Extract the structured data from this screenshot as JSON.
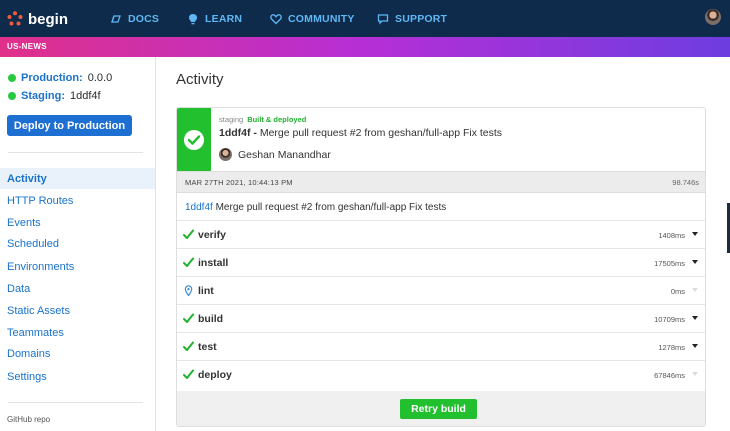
{
  "topnav": {
    "logo_text": "begin",
    "links": [
      {
        "label": "DOCS",
        "icon": "docs-icon"
      },
      {
        "label": "LEARN",
        "icon": "lightbulb-icon"
      },
      {
        "label": "COMMUNITY",
        "icon": "heart-icon"
      },
      {
        "label": "SUPPORT",
        "icon": "chat-icon"
      }
    ]
  },
  "appbar": {
    "app_name": "US-NEWS"
  },
  "sidebar": {
    "production_label": "Production:",
    "production_value": "0.0.0",
    "staging_label": "Staging:",
    "staging_value": "1ddf4f",
    "deploy_button": "Deploy to Production",
    "nav": [
      "Activity",
      "HTTP Routes",
      "Events",
      "Scheduled",
      "Environments",
      "Data",
      "Static Assets",
      "Teammates",
      "Domains",
      "Settings"
    ],
    "active_nav": "Activity",
    "github_link": "GitHub repo"
  },
  "main": {
    "title": "Activity",
    "build": {
      "env": "staging",
      "status": "Built & deployed",
      "sha": "1ddf4f",
      "separator": " - ",
      "commit_message": "Merge pull request #2 from geshan/full-app Fix tests",
      "author": "Geshan Manandhar",
      "date": "MAR 27TH 2021, 10:44:13 PM",
      "duration": "98.746s",
      "message_sha": "1ddf4f",
      "message_text": "Merge pull request #2 from geshan/full-app Fix tests",
      "steps": [
        {
          "name": "verify",
          "time": "1408ms",
          "icon": "check-icon",
          "expandable": true
        },
        {
          "name": "install",
          "time": "17505ms",
          "icon": "check-icon",
          "expandable": true
        },
        {
          "name": "lint",
          "time": "0ms",
          "icon": "pin-icon",
          "expandable": false
        },
        {
          "name": "build",
          "time": "10709ms",
          "icon": "check-icon",
          "expandable": true
        },
        {
          "name": "test",
          "time": "1278ms",
          "icon": "check-icon",
          "expandable": true
        },
        {
          "name": "deploy",
          "time": "67846ms",
          "icon": "check-icon",
          "expandable": false
        }
      ],
      "retry_button": "Retry build"
    }
  },
  "colors": {
    "nav_bg": "#0e2b4c",
    "nav_link": "#5fb8f5",
    "success": "#22c02f",
    "primary": "#1d6fd1",
    "appbar_gradient": [
      "#e0308a",
      "#b62fd6",
      "#6d3de0"
    ]
  }
}
